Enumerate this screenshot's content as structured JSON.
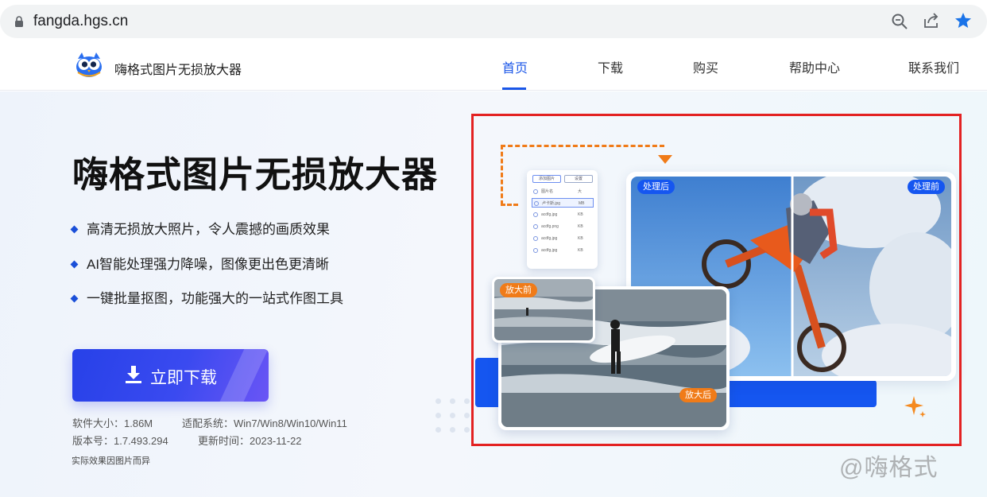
{
  "browser": {
    "url": "fangda.hgs.cn"
  },
  "header": {
    "site_name": "嗨格式图片无损放大器",
    "nav": [
      {
        "label": "首页",
        "active": true
      },
      {
        "label": "下载",
        "active": false
      },
      {
        "label": "购买",
        "active": false
      },
      {
        "label": "帮助中心",
        "active": false
      },
      {
        "label": "联系我们",
        "active": false
      }
    ]
  },
  "hero": {
    "title": "嗨格式图片无损放大器",
    "features": [
      "高清无损放大照片，令人震撼的画质效果",
      "AI智能处理强力降噪，图像更出色更清晰",
      "一键批量抠图，功能强大的一站式作图工具"
    ],
    "download_label": "立即下载",
    "meta": {
      "size": "软件大小：1.86M",
      "system": "适配系统：Win7/Win8/Win10/Win11",
      "version": "版本号：1.7.493.294",
      "updated": "更新时间：2023-11-22"
    },
    "disclaimer": "实际效果因图片而异"
  },
  "showcase": {
    "tag_after_process": "处理后",
    "tag_before_process": "处理前",
    "tag_before_zoom": "放大前",
    "tag_after_zoom": "放大后",
    "mini_panel": {
      "tabs": [
        "添加图片",
        "设置"
      ],
      "rows": [
        {
          "name": "图片名",
          "size": "大"
        },
        {
          "name": "卢卡斯.jpg",
          "size": "MB"
        },
        {
          "name": "acdfg.jpg",
          "size": "KB"
        },
        {
          "name": "acdfg.png",
          "size": "KB"
        },
        {
          "name": "acdfg.jpg",
          "size": "KB"
        },
        {
          "name": "acdfg.jpg",
          "size": "KB"
        }
      ]
    }
  },
  "watermark": "@嗨格式",
  "colors": {
    "accent": "#1a56e8",
    "button_gradient_start": "#2741e8",
    "button_gradient_end": "#6a55f5",
    "highlight_frame": "#e32222",
    "orange": "#f07b18"
  }
}
